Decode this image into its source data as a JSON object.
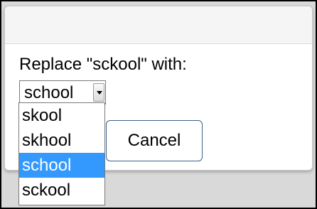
{
  "dialog": {
    "prompt": "Replace \"sckool\" with:",
    "select": {
      "value": "school"
    },
    "cancel_label": "Cancel",
    "options": [
      "skool",
      "skhool",
      "school",
      "sckool"
    ],
    "selected_index": 2,
    "highlight_color": "#3399ff"
  }
}
